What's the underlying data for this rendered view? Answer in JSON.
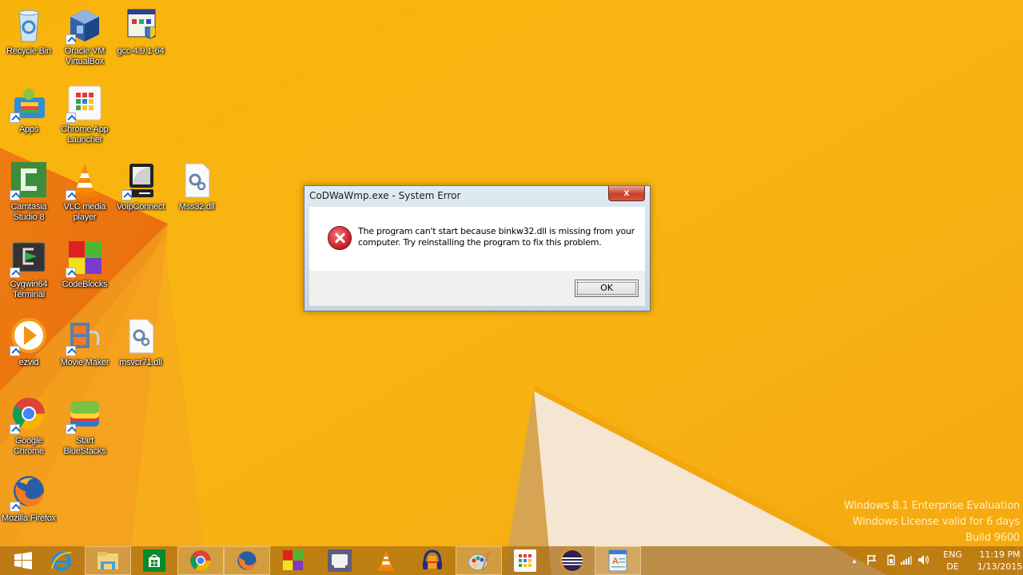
{
  "desktop": {
    "icons": [
      {
        "id": "recycle-bin",
        "label": "Recycle Bin",
        "shortcut": false
      },
      {
        "id": "oracle-vm-virtualbox",
        "label": "Oracle VM VirtualBox",
        "shortcut": true
      },
      {
        "id": "gcc-installer",
        "label": "gcc-4.9.1-64",
        "shortcut": false
      },
      {
        "id": "apps",
        "label": "Apps",
        "shortcut": true
      },
      {
        "id": "chrome-app-launcher",
        "label": "Chrome App Launcher",
        "shortcut": true
      },
      {
        "id": "camtasia-studio",
        "label": "Camtasia Studio 8",
        "shortcut": true
      },
      {
        "id": "vlc-media-player",
        "label": "VLC media player",
        "shortcut": true
      },
      {
        "id": "voipconnect",
        "label": "VoipConnect",
        "shortcut": true
      },
      {
        "id": "mss32-dll",
        "label": "Mss32.dll",
        "shortcut": false
      },
      {
        "id": "cygwin64-terminal",
        "label": "Cygwin64 Terminal",
        "shortcut": true
      },
      {
        "id": "codeblocks",
        "label": "CodeBlocks",
        "shortcut": true
      },
      {
        "id": "ezvid",
        "label": "ezvid",
        "shortcut": true
      },
      {
        "id": "movie-maker",
        "label": "Movie Maker",
        "shortcut": true
      },
      {
        "id": "msvcr71-dll",
        "label": "msvcr71.dll",
        "shortcut": false
      },
      {
        "id": "google-chrome",
        "label": "Google Chrome",
        "shortcut": true
      },
      {
        "id": "start-bluestacks",
        "label": "Start BlueStacks",
        "shortcut": true
      },
      {
        "id": "mozilla-firefox",
        "label": "Mozilla Firefox",
        "shortcut": true
      }
    ]
  },
  "dialog": {
    "title": "CoDWaWmp.exe - System Error",
    "close_label": "x",
    "icon": "error-icon",
    "message": "The program can't start because binkw32.dll is missing from your computer. Try reinstalling the program to fix this problem.",
    "ok_label": "OK"
  },
  "watermark": {
    "line1": "Windows 8.1 Enterprise Evaluation",
    "line2": "Windows License valid for 6 days",
    "line3": "Build 9600"
  },
  "taskbar": {
    "buttons": [
      {
        "id": "start",
        "icon": "windows-logo-icon",
        "active": false
      },
      {
        "id": "internet-explorer",
        "icon": "internet-explorer-icon",
        "active": false
      },
      {
        "id": "file-explorer",
        "icon": "file-explorer-icon",
        "active": true
      },
      {
        "id": "store",
        "icon": "store-icon",
        "active": false
      },
      {
        "id": "chrome",
        "icon": "chrome-icon",
        "active": true
      },
      {
        "id": "firefox",
        "icon": "firefox-icon",
        "active": true
      },
      {
        "id": "codeblocks",
        "icon": "codeblocks-icon",
        "active": false
      },
      {
        "id": "voipconnect",
        "icon": "voipconnect-icon",
        "active": false
      },
      {
        "id": "vlc",
        "icon": "vlc-icon",
        "active": false
      },
      {
        "id": "audacity",
        "icon": "audacity-icon",
        "active": false
      },
      {
        "id": "paint",
        "icon": "paint-palette-icon",
        "active": true
      },
      {
        "id": "chrome-app-launcher",
        "icon": "app-launcher-icon",
        "active": false
      },
      {
        "id": "eclipse",
        "icon": "eclipse-icon",
        "active": false
      },
      {
        "id": "wordpad",
        "icon": "wordpad-icon",
        "active": true
      }
    ],
    "tray": {
      "icons": [
        "show-hidden-icons-icon",
        "action-center-flag-icon",
        "battery-icon",
        "network-signal-icon",
        "volume-icon"
      ],
      "language": "ENG",
      "keyboard": "DE",
      "time": "11:19 PM",
      "date": "1/13/2015"
    }
  },
  "colors": {
    "wallpaper_base": "#f7ad0c",
    "wallpaper_dark_orange": "#e96f10",
    "wallpaper_cream": "#f5e8d2",
    "taskbar": "#a86c14",
    "error_red": "#c8222a"
  }
}
